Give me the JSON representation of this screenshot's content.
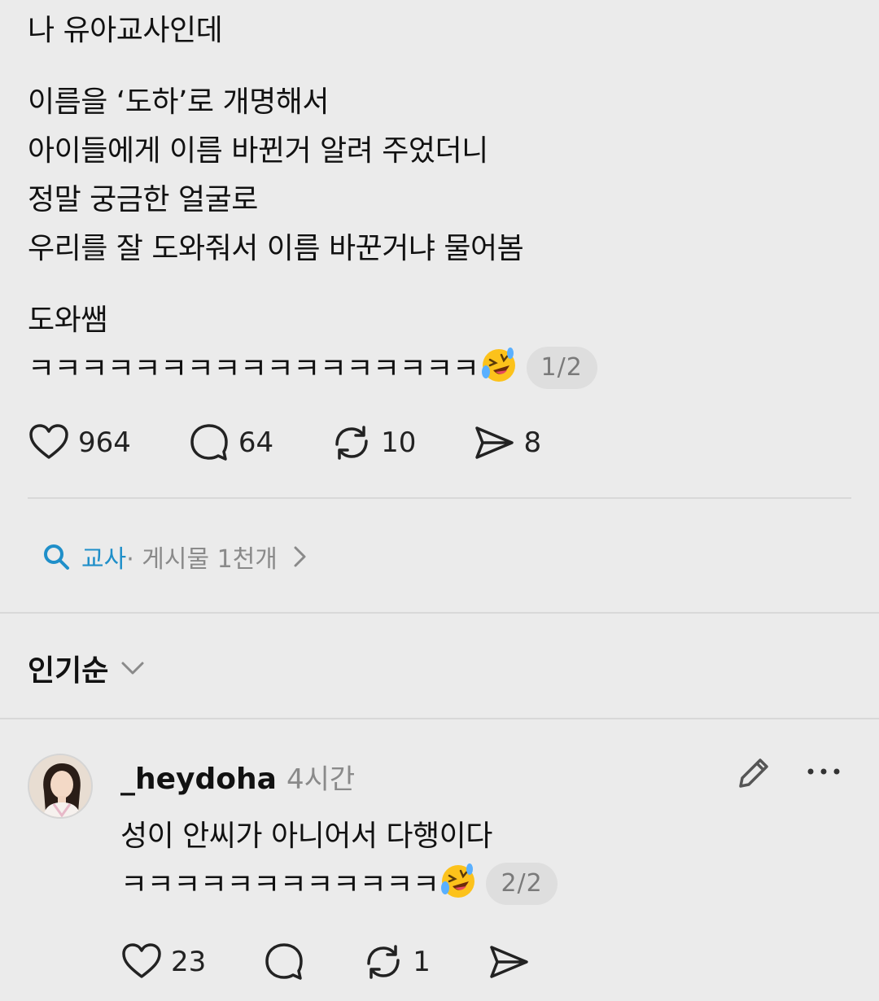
{
  "post": {
    "lines": [
      "나 유아교사인데",
      "이름을 ‘도하’로 개명해서",
      "아이들에게 이름 바뀐거 알려 주었더니",
      "정말 궁금한 얼굴로",
      "우리를 잘 도와줘서 이름 바꾼거냐 물어봄",
      "도와쌤",
      "ㅋㅋㅋㅋㅋㅋㅋㅋㅋㅋㅋㅋㅋㅋㅋㅋㅋ"
    ],
    "emoji": "rolling-on-floor-laughing-emoji",
    "page_indicator": "1/2",
    "stats": {
      "likes": "964",
      "comments": "64",
      "reposts": "10",
      "shares": "8"
    }
  },
  "topic": {
    "tag": "교사",
    "meta": " · 게시물 1천개"
  },
  "sort": {
    "label": "인기순"
  },
  "reply": {
    "username": "_heydoha",
    "time": "4시간",
    "lines": [
      "성이 안씨가 아니어서 다행이다",
      "ㅋㅋㅋㅋㅋㅋㅋㅋㅋㅋㅋㅋ"
    ],
    "page_indicator": "2/2",
    "stats": {
      "likes": "23",
      "reposts": "1"
    }
  },
  "colors": {
    "background": "#ebebeb",
    "accent": "#1f8fc9",
    "muted": "#8a8a8a",
    "divider": "#d8d8d8"
  }
}
